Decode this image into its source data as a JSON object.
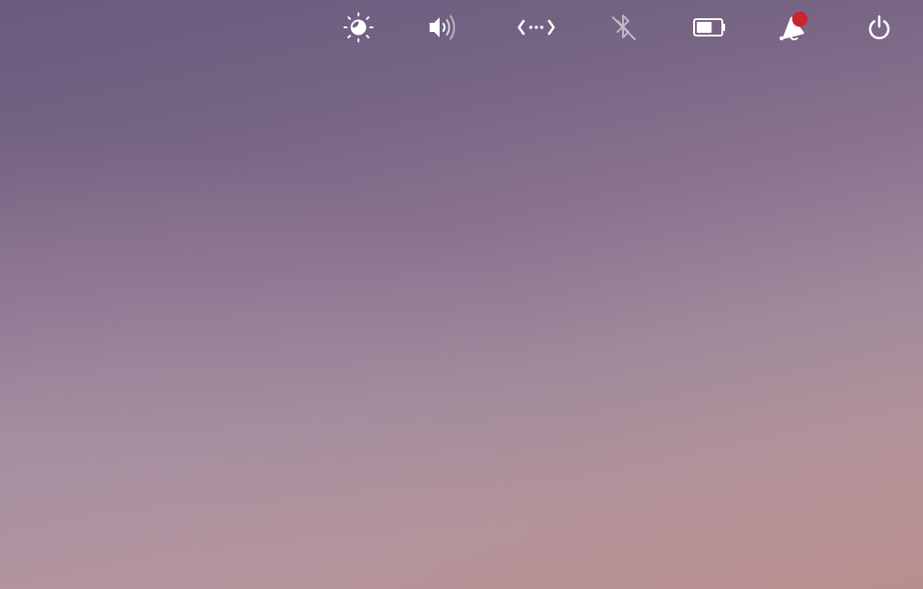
{
  "panel": {
    "indicators": [
      {
        "id": "night-light",
        "icon": "night-light-icon",
        "state": "active"
      },
      {
        "id": "sound",
        "icon": "audio-volume-high-icon",
        "state": "active"
      },
      {
        "id": "network",
        "icon": "network-wired-icon",
        "state": "active"
      },
      {
        "id": "bluetooth",
        "icon": "bluetooth-disabled-icon",
        "state": "disabled"
      },
      {
        "id": "power",
        "icon": "battery-icon",
        "state": "active",
        "battery_level": 0.65
      },
      {
        "id": "notifications",
        "icon": "notification-bell-icon",
        "state": "unread"
      },
      {
        "id": "session",
        "icon": "system-shutdown-icon",
        "state": "active"
      }
    ]
  },
  "colors": {
    "icon": "#ffffff",
    "notification_badge": "#c6262e",
    "wallpaper_top": "#6a5a7e",
    "wallpaper_bottom": "#b88f8e"
  }
}
